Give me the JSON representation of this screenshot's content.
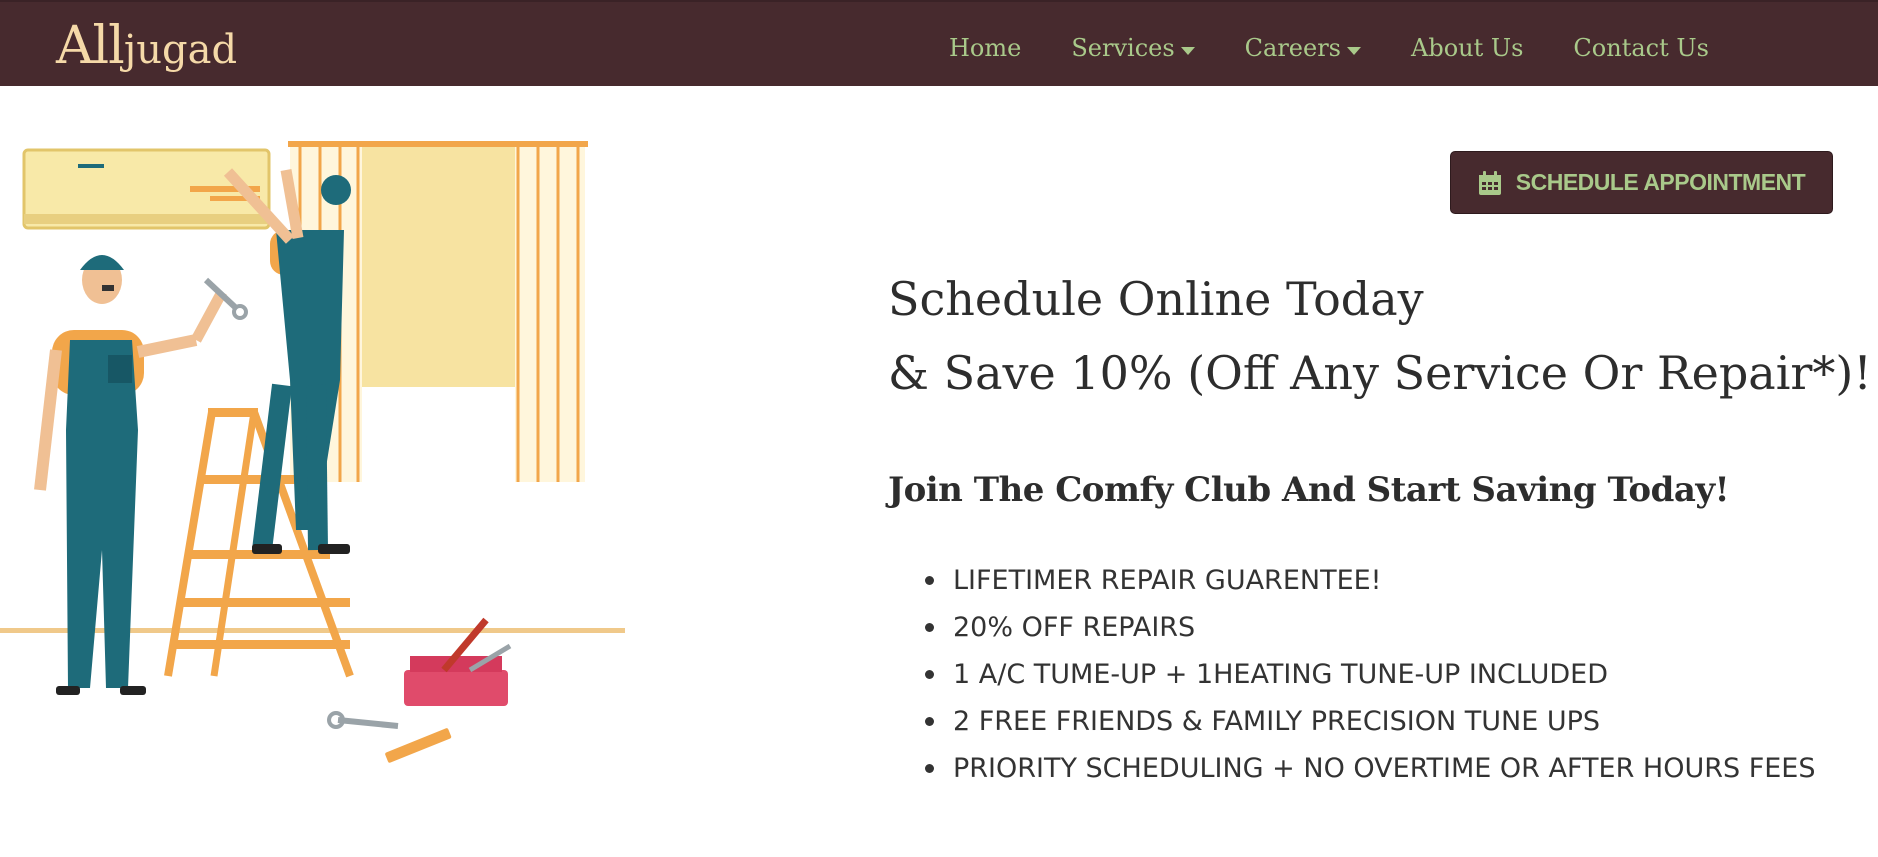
{
  "brand": {
    "logo_first": "All",
    "logo_second": "jugad"
  },
  "nav": {
    "items": [
      {
        "label": "Home",
        "dropdown": false
      },
      {
        "label": "Services",
        "dropdown": true
      },
      {
        "label": "Careers",
        "dropdown": true
      },
      {
        "label": "About Us",
        "dropdown": false
      },
      {
        "label": "Contact Us",
        "dropdown": false
      }
    ]
  },
  "cta": {
    "label": "SCHEDULE APPOINTMENT",
    "icon": "calendar-icon"
  },
  "hero": {
    "headline_line1": "Schedule Online Today",
    "headline_line2": "& Save 10% (Off Any Service Or Repair*)!",
    "subheading": "Join The Comfy Club And Start Saving Today!",
    "benefits": [
      "LIFETIMER REPAIR GUARENTEE!",
      "20% OFF REPAIRS",
      "1 A/C TUME-UP + 1HEATING TUNE-UP INCLUDED",
      "2 FREE FRIENDS & FAMILY PRECISION TUNE UPS",
      "PRIORITY SCHEDULING + NO OVERTIME OR AFTER HOURS FEES"
    ]
  },
  "colors": {
    "header_bg": "#472a2e",
    "nav_text": "#a9c98a",
    "logo_text": "#f5d9a8"
  }
}
